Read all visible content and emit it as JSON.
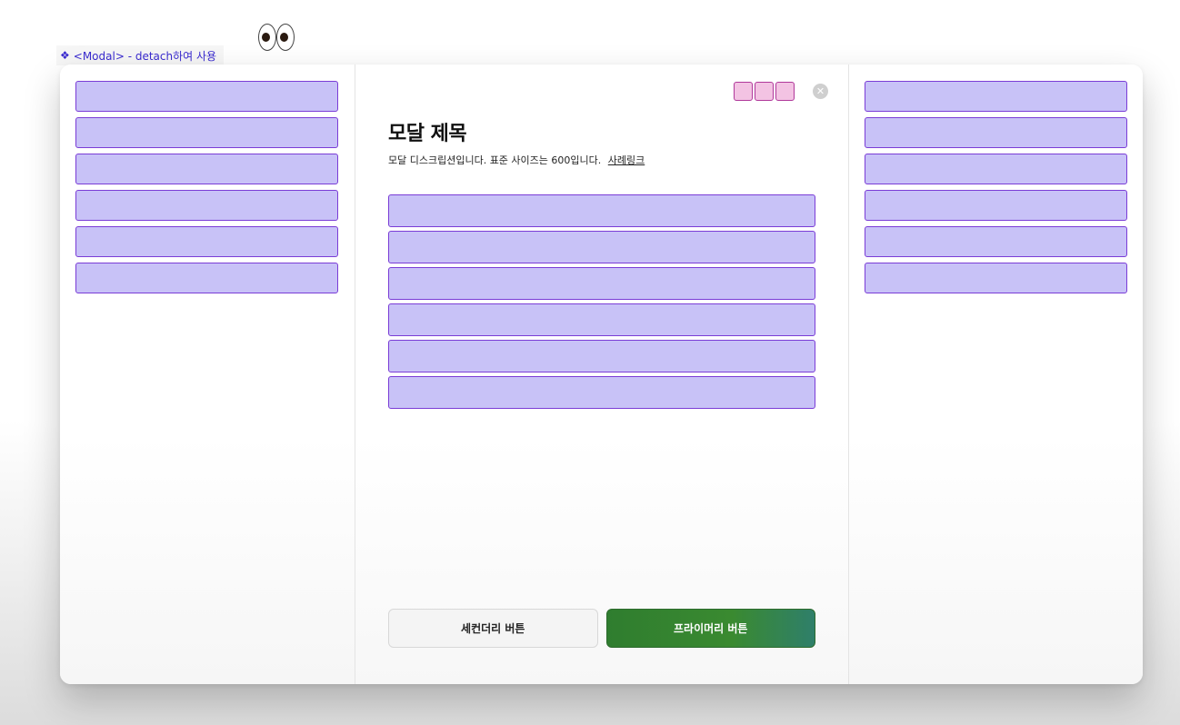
{
  "component_label": {
    "icon": "diamond-icon",
    "text": "<Modal> -  detach하여 사용"
  },
  "decoration": {
    "eyes_icon": "eyes-icon"
  },
  "modal": {
    "title": "모달 제목",
    "description": "모달 디스크립션입니다. 표준 사이즈는 600입니다.",
    "link_text": "사례링크",
    "close_icon": "close-icon",
    "secondary_button": "세컨더리 버튼",
    "primary_button": "프라이머리 버튼",
    "header_slot_count": 3,
    "left_slot_count": 6,
    "center_slot_count": 6,
    "right_slot_count": 6
  },
  "colors": {
    "slot_fill": "#c8c2f7",
    "slot_border": "#7a3cd6",
    "mini_slot_fill": "#f3c3e3",
    "mini_slot_border": "#b0389a",
    "primary_button": "#3a8a30",
    "label_text": "#3a2bd0"
  }
}
